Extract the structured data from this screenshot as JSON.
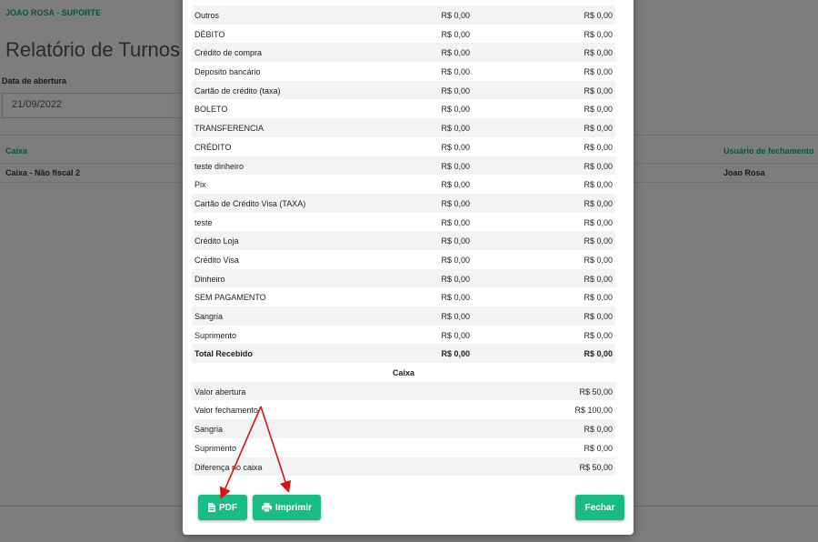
{
  "header": {
    "user": "JOAO ROSA - SUPORTE",
    "title": "Relatório de Turnos"
  },
  "filter": {
    "date_label": "Data de abertura",
    "date_value": "21/09/2022"
  },
  "table": {
    "col_caixa": "Caixa",
    "col_usuario": "Usuário de fechamento",
    "row": {
      "caixa": "Caixa - Não fiscal 2",
      "usuario": "Joao Rosa"
    }
  },
  "modal": {
    "payments": [
      {
        "label": "Outros",
        "v1": "R$ 0,00",
        "v2": "R$ 0,00"
      },
      {
        "label": "DÉBITO",
        "v1": "R$ 0,00",
        "v2": "R$ 0,00"
      },
      {
        "label": "Crédito de compra",
        "v1": "R$ 0,00",
        "v2": "R$ 0,00"
      },
      {
        "label": "Deposito bancário",
        "v1": "R$ 0,00",
        "v2": "R$ 0,00"
      },
      {
        "label": "Cartão de crédito (taxa)",
        "v1": "R$ 0,00",
        "v2": "R$ 0,00"
      },
      {
        "label": "BOLETO",
        "v1": "R$ 0,00",
        "v2": "R$ 0,00"
      },
      {
        "label": "TRANSFERENCIA",
        "v1": "R$ 0,00",
        "v2": "R$ 0,00"
      },
      {
        "label": "CRÉDITO",
        "v1": "R$ 0,00",
        "v2": "R$ 0,00"
      },
      {
        "label": "teste dinheiro",
        "v1": "R$ 0,00",
        "v2": "R$ 0,00"
      },
      {
        "label": "Pix",
        "v1": "R$ 0,00",
        "v2": "R$ 0,00"
      },
      {
        "label": "Cartão de Crédito Visa (TAXA)",
        "v1": "R$ 0,00",
        "v2": "R$ 0,00"
      },
      {
        "label": "teste",
        "v1": "R$ 0,00",
        "v2": "R$ 0,00"
      },
      {
        "label": "Crédito Loja",
        "v1": "R$ 0,00",
        "v2": "R$ 0,00"
      },
      {
        "label": "Crédito Visa",
        "v1": "R$ 0,00",
        "v2": "R$ 0,00"
      },
      {
        "label": "Dinheiro",
        "v1": "R$ 0,00",
        "v2": "R$ 0,00"
      },
      {
        "label": "SEM PAGAMENTO",
        "v1": "R$ 0,00",
        "v2": "R$ 0,00"
      },
      {
        "label": "Sangria",
        "v1": "R$ 0,00",
        "v2": "R$ 0,00"
      },
      {
        "label": "Suprimento",
        "v1": "R$ 0,00",
        "v2": "R$ 0,00"
      }
    ],
    "total": {
      "label": "Total Recebido",
      "v1": "R$ 0,00",
      "v2": "R$ 0,00"
    },
    "caixa_title": "Caixa",
    "caixa_rows": [
      {
        "label": "Valor abertura",
        "value": "R$ 50,00"
      },
      {
        "label": "Valor fechamento",
        "value": "R$ 100,00"
      },
      {
        "label": "Sangria",
        "value": "R$ 0,00"
      },
      {
        "label": "Suprimento",
        "value": "R$ 0,00"
      },
      {
        "label": "Diferença no caixa",
        "value": "R$ 50,00"
      }
    ],
    "buttons": {
      "pdf": "PDF",
      "print": "Imprimir",
      "close": "Fechar"
    }
  },
  "colors": {
    "accent": "#1abc85",
    "header_green": "#1aa37a",
    "arrow": "#e01010"
  }
}
